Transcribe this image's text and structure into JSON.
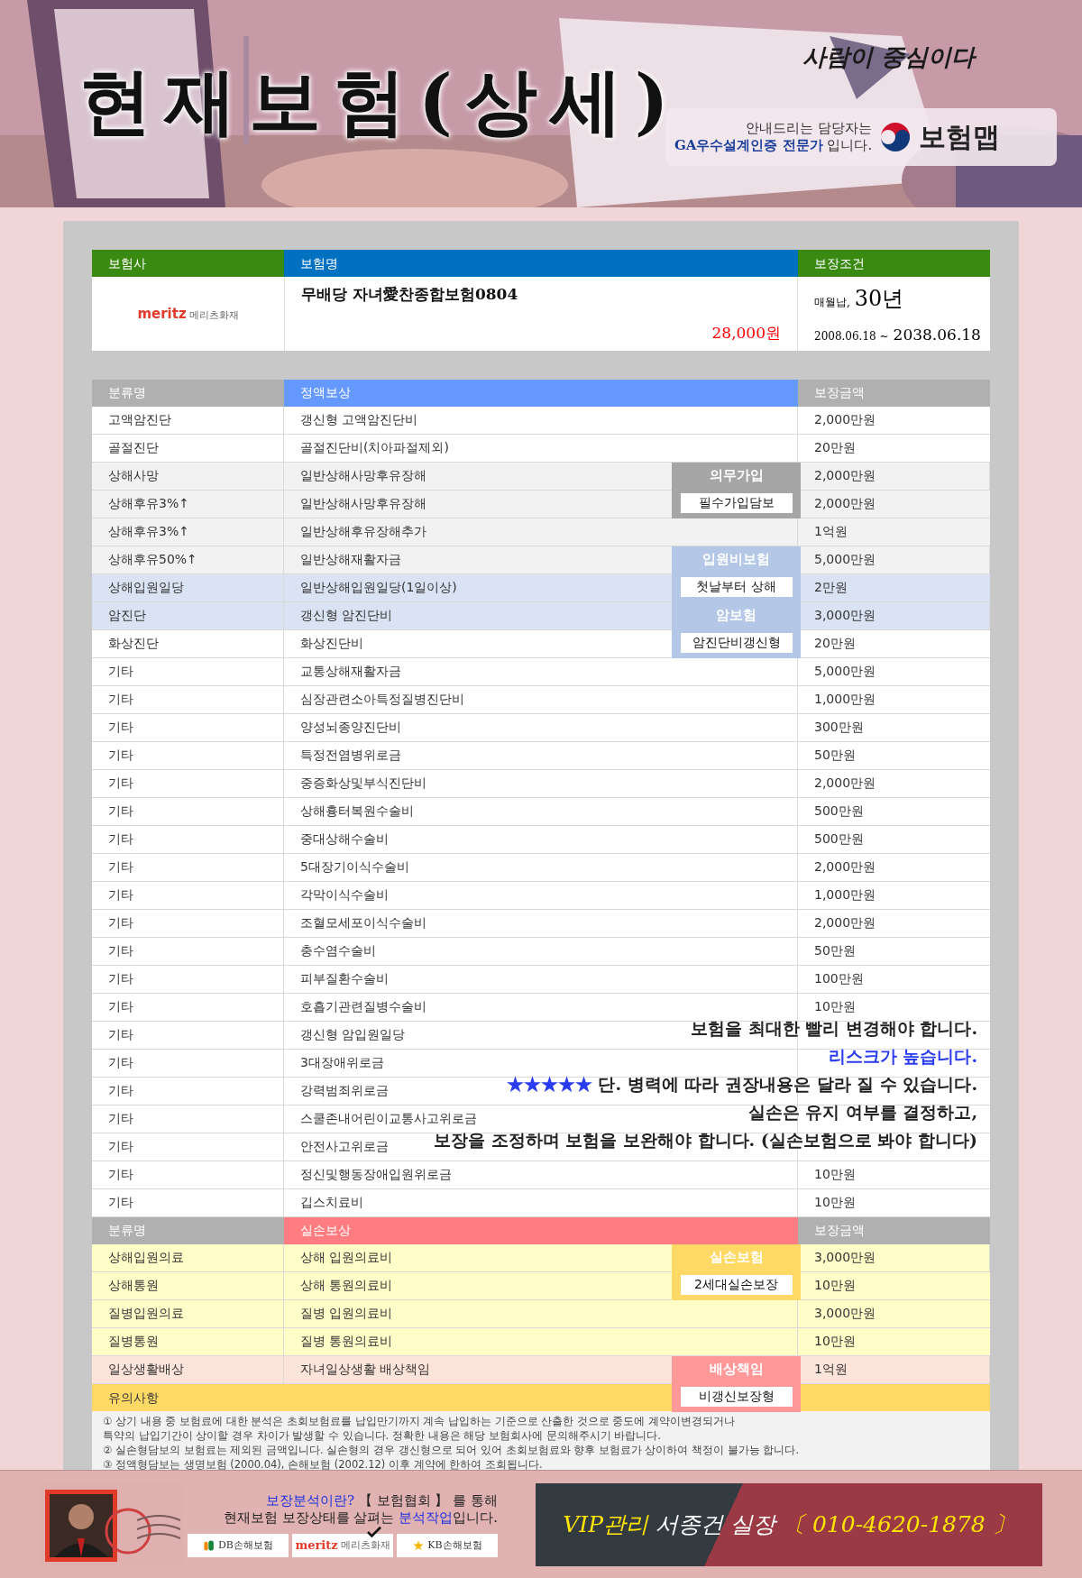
{
  "header": {
    "title": "현재보험(상세)",
    "slogan": "사람이 중심이다",
    "guide_lines": [
      "안내드리는 담당자는",
      "**GA우수설계인증 전문가** 입니다."
    ],
    "brand": "보험맵"
  },
  "policy": {
    "columns": [
      "보험사",
      "보험명",
      "보장조건"
    ],
    "insurer": {
      "wordmark": "meritz",
      "name": "메리츠화재"
    },
    "product": "무배당 자녀愛찬종합보험0804",
    "premium": "28,000원",
    "payment": "매월납,",
    "term": "30년",
    "start": "2008.06.18 ~",
    "end": "2038.06.18"
  },
  "fixed": {
    "columns": [
      "분류명",
      "정액보상",
      "보장금액"
    ],
    "rows": [
      {
        "category": "고액암진단",
        "coverage": "갱신형 고액암진단비",
        "amount": "2,000만원",
        "color": "#ffffff"
      },
      {
        "category": "골절진단",
        "coverage": "골절진단비(치아파절제외)",
        "amount": "20만원",
        "color": "#ffffff"
      },
      {
        "category": "상해사망",
        "coverage": "일반상해사망후유장해",
        "amount": "2,000만원",
        "color": "#f2f2f2",
        "badge": {
          "title": "의무가입",
          "label": "필수가입담보",
          "color": "#a6a6a6"
        }
      },
      {
        "category": "상해후유3%↑",
        "coverage": "일반상해사망후유장해",
        "amount": "2,000만원",
        "color": "#f2f2f2"
      },
      {
        "category": "상해후유3%↑",
        "coverage": "일반상해후유장해추가",
        "amount": "1억원",
        "color": "#f2f2f2"
      },
      {
        "category": "상해후유50%↑",
        "coverage": "일반상해재활자금",
        "amount": "5,000만원",
        "color": "#f2f2f2",
        "badge": {
          "title": "입원비보험",
          "label": "첫날부터 상해",
          "color": "#b4c7e7"
        }
      },
      {
        "category": "상해입원일당",
        "coverage": "일반상해입원일당(1일이상)",
        "amount": "2만원",
        "color": "#dae3f3"
      },
      {
        "category": "암진단",
        "coverage": "갱신형 암진단비",
        "amount": "3,000만원",
        "color": "#dae3f3",
        "badge": {
          "title": "암보험",
          "label": "암진단비갱신형",
          "color": "#b4c7e7"
        }
      },
      {
        "category": "화상진단",
        "coverage": "화상진단비",
        "amount": "20만원",
        "color": "#ffffff"
      },
      {
        "category": "기타",
        "coverage": "교통상해재활자금",
        "amount": "5,000만원",
        "color": "#ffffff"
      },
      {
        "category": "기타",
        "coverage": "심장관련소아특정질병진단비",
        "amount": "1,000만원",
        "color": "#ffffff"
      },
      {
        "category": "기타",
        "coverage": "양성뇌종양진단비",
        "amount": "300만원",
        "color": "#ffffff"
      },
      {
        "category": "기타",
        "coverage": "특정전염병위로금",
        "amount": "50만원",
        "color": "#ffffff"
      },
      {
        "category": "기타",
        "coverage": "중증화상및부식진단비",
        "amount": "2,000만원",
        "color": "#ffffff"
      },
      {
        "category": "기타",
        "coverage": "상해흉터복원수술비",
        "amount": "500만원",
        "color": "#ffffff"
      },
      {
        "category": "기타",
        "coverage": "중대상해수술비",
        "amount": "500만원",
        "color": "#ffffff"
      },
      {
        "category": "기타",
        "coverage": "5대장기이식수술비",
        "amount": "2,000만원",
        "color": "#ffffff"
      },
      {
        "category": "기타",
        "coverage": "각막이식수술비",
        "amount": "1,000만원",
        "color": "#ffffff"
      },
      {
        "category": "기타",
        "coverage": "조혈모세포이식수술비",
        "amount": "2,000만원",
        "color": "#ffffff"
      },
      {
        "category": "기타",
        "coverage": "충수염수술비",
        "amount": "50만원",
        "color": "#ffffff"
      },
      {
        "category": "기타",
        "coverage": "피부질환수술비",
        "amount": "100만원",
        "color": "#ffffff"
      },
      {
        "category": "기타",
        "coverage": "호흡기관련질병수술비",
        "amount": "10만원",
        "color": "#ffffff"
      },
      {
        "category": "기타",
        "coverage": "갱신형 암입원일당",
        "color": "#ffffff"
      },
      {
        "category": "기타",
        "coverage": "3대장애위로금",
        "color": "#ffffff"
      },
      {
        "category": "기타",
        "coverage": "강력범죄위로금",
        "color": "#ffffff"
      },
      {
        "category": "기타",
        "coverage": "스쿨존내어린이교통사고위로금",
        "color": "#ffffff"
      },
      {
        "category": "기타",
        "coverage": "안전사고위로금",
        "color": "#ffffff"
      },
      {
        "category": "기타",
        "coverage": "정신및행동장애입원위로금",
        "amount": "10만원",
        "color": "#ffffff"
      },
      {
        "category": "기타",
        "coverage": "깁스치료비",
        "amount": "10만원",
        "color": "#ffffff"
      }
    ],
    "notice": [
      [
        {
          "text": "보험을 최대한 빨리 변경해야 합니다.",
          "highlight": false
        }
      ],
      [
        {
          "text": "리스크가 높습니다.",
          "highlight": true
        }
      ],
      [
        {
          "text": "★★★★★",
          "highlight": true
        },
        {
          "text": " 단. 병력에 따라 권장내용은 달라 질 수 있습니다.",
          "highlight": false
        }
      ],
      [
        {
          "text": "실손은 유지 여부를 결정하고,",
          "highlight": false
        }
      ],
      [
        {
          "text": "보장을 조정하며 보험을 보완해야 합니다. (실손보험으로 봐야 합니다)",
          "highlight": false
        }
      ]
    ]
  },
  "actual": {
    "columns": [
      "분류명",
      "실손보상",
      "보장금액"
    ],
    "rows": [
      {
        "category": "상해입원의료",
        "coverage": "상해 입원의료비",
        "amount": "3,000만원",
        "color": "#fffdc8",
        "badge": {
          "title": "실손보험",
          "label": "2세대실손보장",
          "color": "#ffd966"
        }
      },
      {
        "category": "상해통원",
        "coverage": "상해 통원의료비",
        "amount": "10만원",
        "color": "#fffdc8"
      },
      {
        "category": "질병입원의료",
        "coverage": "질병 입원의료비",
        "amount": "3,000만원",
        "color": "#fffdc8"
      },
      {
        "category": "질병통원",
        "coverage": "질병 통원의료비",
        "amount": "10만원",
        "color": "#fffdc8"
      },
      {
        "category": "일상생활배상",
        "coverage": "자녀일상생활 배상책임",
        "amount": "1억원",
        "color": "#fde4da",
        "badge": {
          "title": "배상책임",
          "label": "비갱신보장형",
          "color": "#ff9999"
        }
      }
    ],
    "caution_title": "유의사항",
    "notes": [
      "① 상기 내용 중 보험료에 대한 분석은 초회보험료를 납입만기까지 계속 납입하는 기준으로 산출한 것으로 중도에 계약이변경되거나",
      "특약의 납입기간이 상이할 경우 차이가 발생할 수 있습니다. 정확한 내용은 해당 보험회사에 문의해주시기 바랍니다.",
      "② 실손형담보의 보험료는 제외된 금액입니다. 실손형의 경우 갱신형으로 되어 있어 초회보험료와 향후 보험료가 상이하여 책정이 불가능 합니다.",
      "③ 정액형담보는 생명보험 (2000.04), 손해보험 (2002.12) 이후 계약에 한하여 조회됩니다."
    ]
  },
  "footer": {
    "intro": [
      "**보장분석이란?** 【 보험협회 】 를 통해",
      "현재보험 보장상태를 살펴는 **분석작업**입니다."
    ],
    "logos": [
      {
        "kind": "db",
        "text": "DB손해보험",
        "checked": false
      },
      {
        "kind": "meritz",
        "wordmark": "meritz",
        "text": "메리츠화재",
        "checked": true
      },
      {
        "kind": "kb",
        "text": "KB손해보험",
        "checked": false
      }
    ],
    "contact": {
      "tag": "VIP관리",
      "name": "서종건 실장",
      "phone": "〔 010-4620-1878 〕"
    }
  }
}
